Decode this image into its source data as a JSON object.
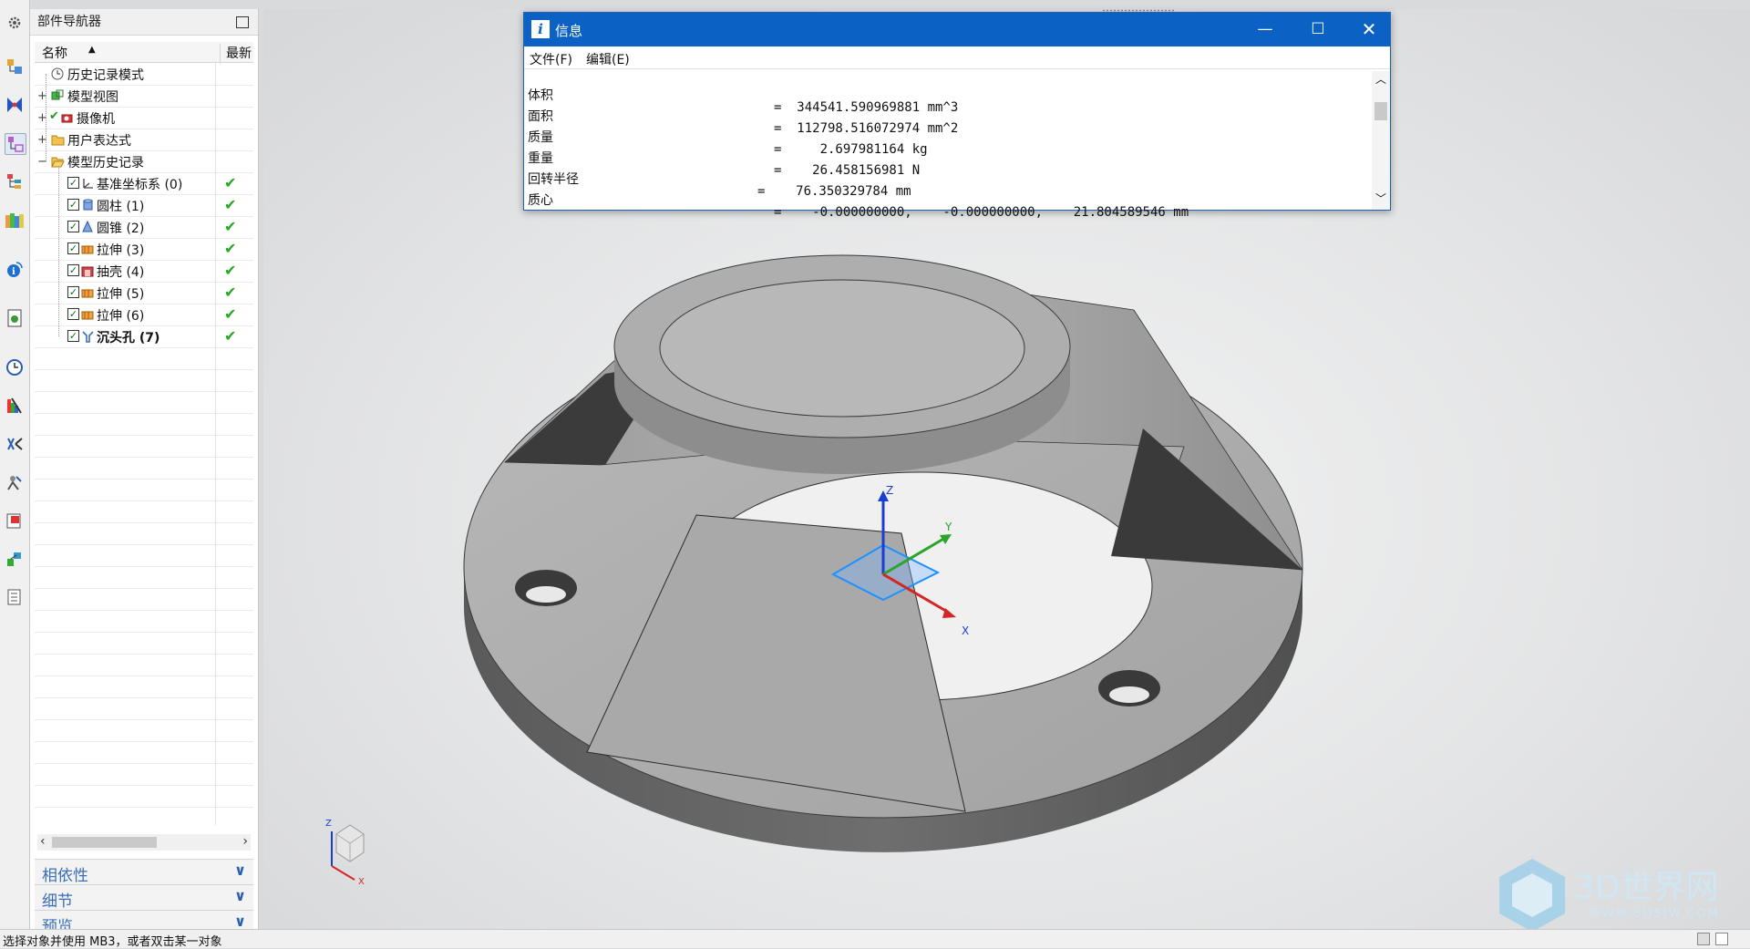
{
  "resource_bar": {
    "icons": [
      "gear-icon",
      "assembly-navigator-icon",
      "constraint-navigator-icon",
      "part-navigator-icon",
      "reuse-library-icon",
      "hd3d-tools-icon",
      "web-browser-icon",
      "history-icon",
      "process-studio-icon",
      "manufacturing-wizard-icon",
      "role-icon",
      "system-materials-icon",
      "palette-icon",
      "roles-library-icon"
    ]
  },
  "navigator": {
    "title": "部件导航器",
    "columns": {
      "name": "名称",
      "latest": "最新"
    },
    "items": [
      {
        "label": "历史记录模式",
        "level": 0,
        "expander": "",
        "icon": "history-mode-icon"
      },
      {
        "label": "模型视图",
        "level": 0,
        "expander": "+",
        "icon": "model-views-icon"
      },
      {
        "label": "摄像机",
        "level": 0,
        "expander": "+",
        "icon": "camera-icon"
      },
      {
        "label": "用户表达式",
        "level": 0,
        "expander": "+",
        "icon": "folder-icon"
      },
      {
        "label": "模型历史记录",
        "level": 0,
        "expander": "−",
        "icon": "folder-open-icon"
      },
      {
        "label": "基准坐标系 (0)",
        "level": 1,
        "icon": "datum-csys-icon",
        "status": "✔"
      },
      {
        "label": "圆柱 (1)",
        "level": 1,
        "icon": "cylinder-icon",
        "status": "✔"
      },
      {
        "label": "圆锥 (2)",
        "level": 1,
        "icon": "cone-icon",
        "status": "✔"
      },
      {
        "label": "拉伸 (3)",
        "level": 1,
        "icon": "extrude-icon",
        "status": "✔"
      },
      {
        "label": "抽壳 (4)",
        "level": 1,
        "icon": "shell-icon",
        "status": "✔"
      },
      {
        "label": "拉伸 (5)",
        "level": 1,
        "icon": "extrude-icon",
        "status": "✔"
      },
      {
        "label": "拉伸 (6)",
        "level": 1,
        "icon": "extrude-icon",
        "status": "✔"
      },
      {
        "label": "沉头孔 (7)",
        "level": 1,
        "icon": "countersunk-hole-icon",
        "status": "✔",
        "bold": true
      }
    ],
    "sections": [
      "相依性",
      "细节",
      "预览"
    ]
  },
  "info_window": {
    "title": "信息",
    "menu": [
      "文件(F)",
      "编辑(E)"
    ],
    "lines": [
      {
        "key": "体积",
        "value": "=  344541.590969881 mm^3"
      },
      {
        "key": "面积",
        "value": "=  112798.516072974 mm^2"
      },
      {
        "key": "质量",
        "value": "=     2.697981164 kg"
      },
      {
        "key": "重量",
        "value": "=    26.458156981 N"
      },
      {
        "key": "回转半径",
        "value": "=    76.350329784 mm"
      },
      {
        "key": "质心",
        "value": "=    -0.000000000,    -0.000000000,    21.804589546 mm"
      }
    ]
  },
  "viewport": {
    "triad_labels": {
      "x": "X",
      "y": "Y",
      "z": "Z"
    },
    "view_triad_labels": {
      "x": "X",
      "z": "Z"
    }
  },
  "status": {
    "text": "选择对象并使用 MB3，或者双击某一对象"
  },
  "watermark": {
    "brand": "3D世界网",
    "url": "WWW.3DSJW.COM"
  }
}
